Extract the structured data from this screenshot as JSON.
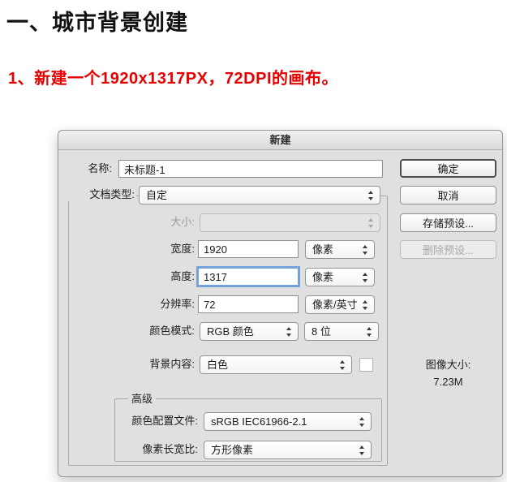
{
  "page": {
    "heading": "一、城市背景创建",
    "step_note": "1、新建一个1920x1317PX，72DPI的画布。"
  },
  "dialog": {
    "title": "新建",
    "fields": {
      "name": {
        "label": "名称:",
        "value": "未标题-1"
      },
      "doc_type": {
        "label": "文档类型:",
        "value": "自定"
      },
      "size": {
        "label": "大小:",
        "value": ""
      },
      "width": {
        "label": "宽度:",
        "value": "1920",
        "unit": "像素"
      },
      "height": {
        "label": "高度:",
        "value": "1317",
        "unit": "像素"
      },
      "resolution": {
        "label": "分辨率:",
        "value": "72",
        "unit": "像素/英寸"
      },
      "color_mode": {
        "label": "颜色模式:",
        "value": "RGB 颜色",
        "bit_depth": "8 位"
      },
      "background": {
        "label": "背景内容:",
        "value": "白色",
        "swatch_color": "#ffffff"
      },
      "advanced": {
        "legend": "高级",
        "color_profile": {
          "label": "颜色配置文件:",
          "value": "sRGB IEC61966-2.1"
        },
        "pixel_aspect": {
          "label": "像素长宽比:",
          "value": "方形像素"
        }
      }
    },
    "buttons": {
      "ok": "确定",
      "cancel": "取消",
      "save_preset": "存储预设...",
      "delete_preset": "删除预设..."
    },
    "image_size": {
      "label": "图像大小:",
      "value": "7.23M"
    }
  },
  "colors": {
    "accent_red": "#e60000",
    "focus_ring": "#74a2d9",
    "dialog_bg": "#e0e0e0",
    "swatch": "#ffffff"
  }
}
